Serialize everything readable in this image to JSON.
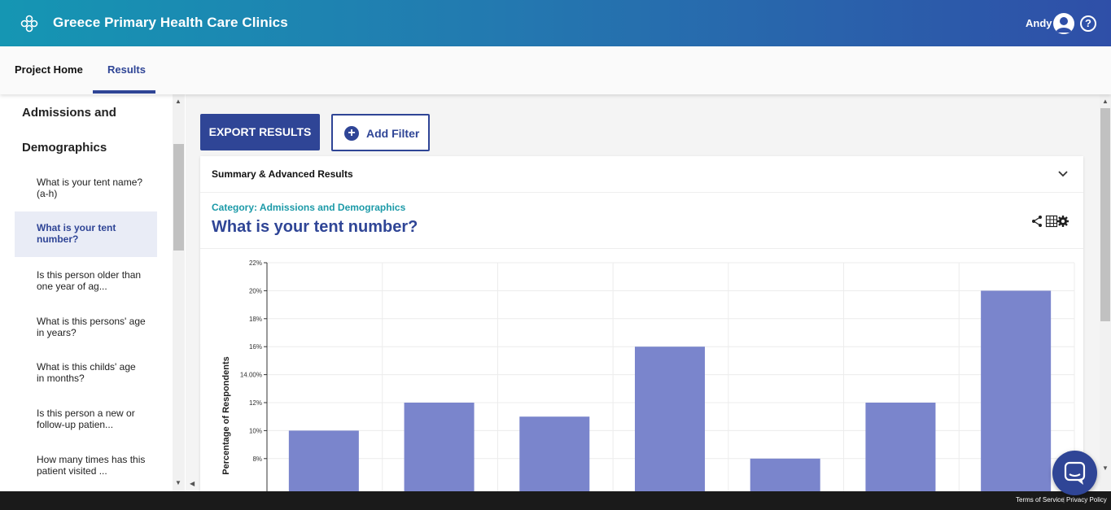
{
  "header": {
    "app_title": "Greece Primary Health Care Clinics",
    "user_name": "Andy",
    "help_glyph": "?",
    "logo_icon": "clover-logo-icon",
    "avatar_icon": "user-avatar-icon"
  },
  "nav": {
    "tabs": [
      {
        "label": "Project Home"
      },
      {
        "label": "Results"
      }
    ],
    "active_tab": "Results"
  },
  "sidebar": {
    "category_line1": "Admissions and",
    "category_line2": "Demographics",
    "items": [
      {
        "label": "What is your tent name? (a-h)"
      },
      {
        "label": "What is your tent number?"
      },
      {
        "label": "Is this person older than one year of ag..."
      },
      {
        "label": "What is this persons' age in years?"
      },
      {
        "label": "What is this childs' age in months?"
      },
      {
        "label": "Is this person a new or follow-up patien..."
      },
      {
        "label": "How many times has this patient visited ..."
      }
    ]
  },
  "toolbar": {
    "export_label": "EXPORT RESULTS",
    "filter_label": "Add Filter",
    "filter_plus": "+"
  },
  "card": {
    "summary_label": "Summary & Advanced Results",
    "category": "Category: Admissions and Demographics",
    "question": "What is your tent number?"
  },
  "chart_data": {
    "type": "bar",
    "ylabel": "Percentage of Respondents",
    "ytick_labels": [
      "8%",
      "10%",
      "12%",
      "14.00%",
      "16%",
      "18%",
      "20%",
      "22%"
    ],
    "ytick_values": [
      8,
      10,
      12,
      14,
      16,
      18,
      20,
      22
    ],
    "ylim_visible": [
      6.5,
      22
    ],
    "values": [
      10,
      12,
      11,
      16,
      8,
      12,
      20
    ],
    "bar_color": "#7a85cc",
    "grid": true
  },
  "footer": {
    "terms": "Terms of Service",
    "separator": "|",
    "privacy": "Privacy Policy"
  },
  "colors": {
    "primary": "#2f4596",
    "accent_teal": "#1c9aa8"
  }
}
